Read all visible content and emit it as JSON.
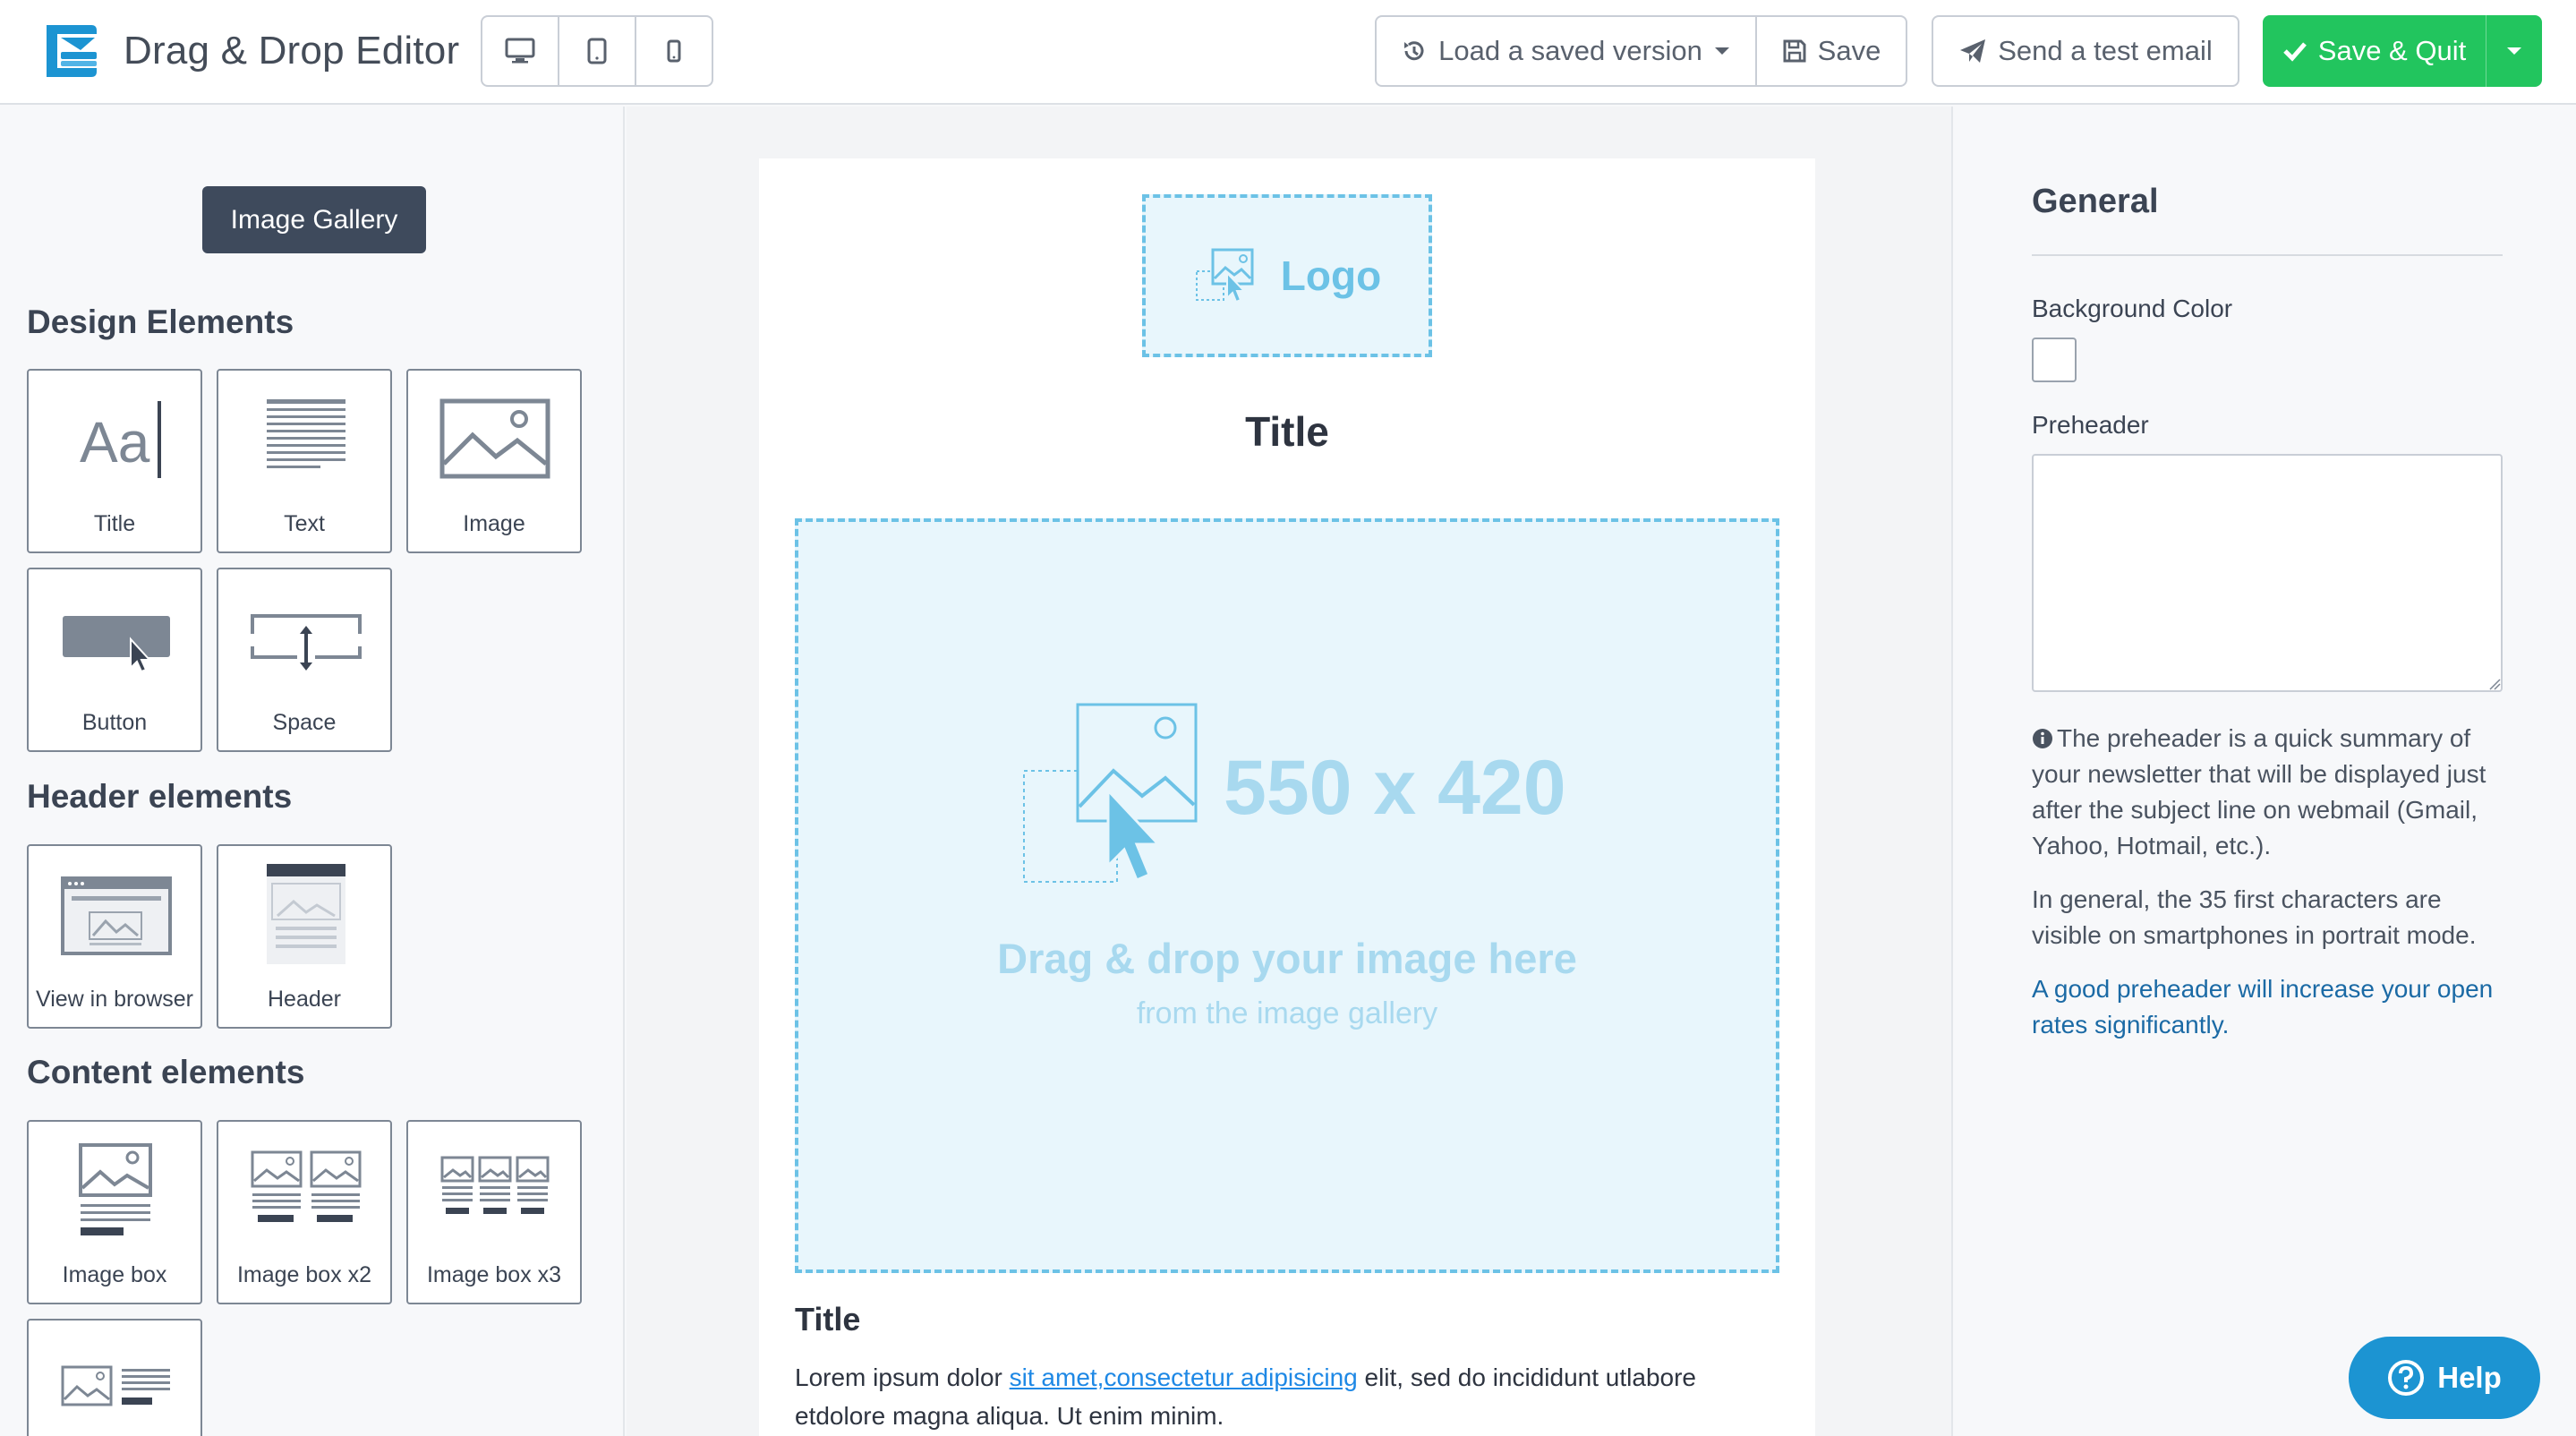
{
  "app": {
    "title": "Drag & Drop Editor",
    "brand_color": "#1c94d2"
  },
  "toolbar": {
    "device_buttons": [
      {
        "name": "desktop-icon",
        "active": true
      },
      {
        "name": "tablet-icon",
        "active": false
      },
      {
        "name": "mobile-icon",
        "active": false
      }
    ],
    "load_version_label": "Load a saved version",
    "save_label": "Save",
    "send_test_label": "Send a test email",
    "save_quit_label": "Save & Quit",
    "primary_color": "#22c55e"
  },
  "left_panel": {
    "gallery_button": "Image Gallery",
    "sections": {
      "design": {
        "title": "Design Elements",
        "items": [
          "Title",
          "Text",
          "Image",
          "Button",
          "Space"
        ]
      },
      "header": {
        "title": "Header elements",
        "items": [
          "View in browser",
          "Header"
        ]
      },
      "content": {
        "title": "Content elements",
        "items": [
          "Image box",
          "Image box x2",
          "Image box x3"
        ]
      }
    }
  },
  "email": {
    "logo_text": "Logo",
    "title": "Title",
    "dropzone": {
      "dimensions": "550 x 420",
      "main_text": "Drag & drop your image here",
      "sub_text": "from the image gallery"
    },
    "content_title": "Title",
    "body": {
      "before": "Lorem ipsum dolor ",
      "link": "sit amet,consectetur adipisicing",
      "after": " elit, sed do incididunt utlabore etdolore magna aliqua. Ut enim minim."
    },
    "accent_color": "#6cc2e6"
  },
  "right_panel": {
    "title": "General",
    "background_color_label": "Background Color",
    "background_color_value": "#ffffff",
    "preheader_label": "Preheader",
    "preheader_value": "",
    "info_text": "The preheader is a quick summary of your newsletter that will be displayed just after the subject line on webmail (Gmail, Yahoo, Hotmail, etc.).",
    "info_text_2": "In general, the 35 first characters are visible on smartphones in portrait mode.",
    "info_link": "A good preheader will increase your open rates significantly."
  },
  "help": {
    "label": "Help"
  }
}
